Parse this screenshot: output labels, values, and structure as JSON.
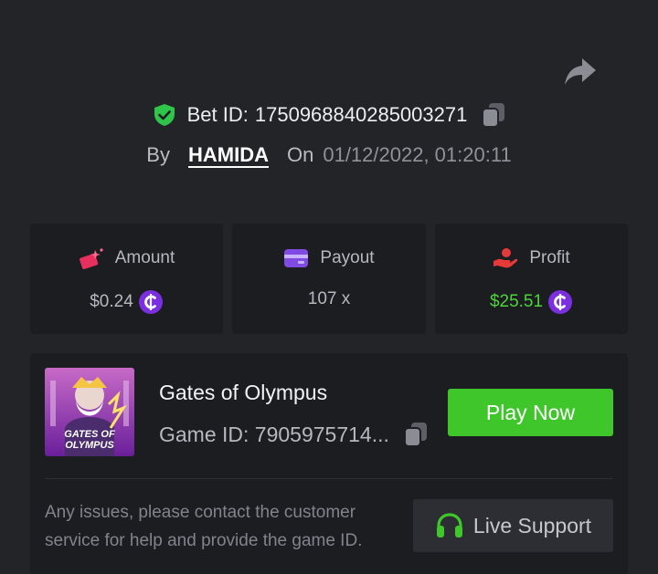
{
  "header": {
    "bet_id_label": "Bet ID:",
    "bet_id": "1750968840285003271",
    "by_label": "By",
    "username": "HAMIDA",
    "on_label": "On",
    "datetime": "01/12/2022, 01:20:11"
  },
  "stats": {
    "amount": {
      "label": "Amount",
      "value": "$0.24"
    },
    "payout": {
      "label": "Payout",
      "value": "107 x"
    },
    "profit": {
      "label": "Profit",
      "value": "$25.51"
    }
  },
  "game": {
    "title": "Gates of Olympus",
    "game_id": "Game ID: 7905975714...",
    "thumb_text_line1": "GATES OF",
    "thumb_text_line2": "OLYMPUS",
    "play_label": "Play Now"
  },
  "support": {
    "message": "Any issues, please contact the customer service for help and provide the game ID.",
    "button_label": "Live Support"
  },
  "icons": {
    "share": "share-icon",
    "verified": "shield-check-icon",
    "copy": "copy-icon",
    "amount": "bet-chip-icon",
    "payout": "wallet-icon",
    "profit": "hand-money-icon",
    "coin": "coin-icon",
    "headset": "headset-icon"
  },
  "colors": {
    "background": "#232428",
    "card": "#1c1d21",
    "accent_green": "#3ec62a",
    "profit_green": "#4fd33b",
    "coin_purple": "#7b2fe0",
    "amount_pink": "#e8305e",
    "payout_purple": "#7f4be3",
    "profit_red": "#e63a3a"
  }
}
